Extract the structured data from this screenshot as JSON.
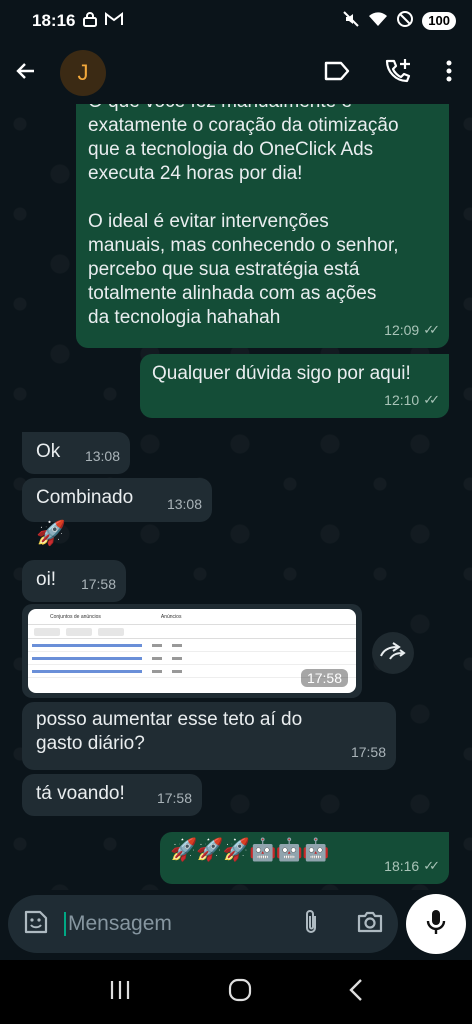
{
  "status_bar": {
    "time": "18:16",
    "battery": "100"
  },
  "header": {
    "avatar_initial": "J"
  },
  "messages": [
    {
      "type": "outgoing",
      "text_lines": [
        "O que você fez manualmente é",
        "exatamente o coração da otimização",
        "que a tecnologia do OneClick Ads",
        "executa 24 horas por dia!",
        "",
        "O ideal é evitar intervenções",
        "manuais, mas conhecendo o senhor,",
        "percebo que sua estratégia está",
        "totalmente alinhada com as ações",
        "da tecnologia hahahah"
      ],
      "time": "12:09"
    },
    {
      "type": "outgoing",
      "text": "Qualquer dúvida sigo por aqui!",
      "time": "12:10"
    },
    {
      "type": "incoming",
      "text": "Ok",
      "time": "13:08"
    },
    {
      "type": "incoming",
      "text": "Combinado",
      "time": "13:08"
    },
    {
      "type": "incoming",
      "text": "🚀",
      "time": ""
    },
    {
      "type": "incoming",
      "text": "oi!",
      "time": "17:58"
    },
    {
      "type": "incoming-image",
      "time": "17:58",
      "thumb_tabs": [
        "Conjuntos de anúncios",
        "Anúncios"
      ]
    },
    {
      "type": "incoming",
      "text_lines": [
        "posso aumentar esse teto aí do",
        "gasto diário?"
      ],
      "time": "17:58"
    },
    {
      "type": "incoming",
      "text": "tá voando!",
      "time": "17:58"
    },
    {
      "type": "outgoing",
      "text": "🚀🚀🚀🤖🤖🤖",
      "time": "18:16"
    }
  ],
  "input": {
    "placeholder": "Mensagem"
  },
  "colors": {
    "background": "#0b141a",
    "outgoing_bubble": "#144d37",
    "incoming_bubble": "#202c33",
    "accent": "#00a884"
  }
}
